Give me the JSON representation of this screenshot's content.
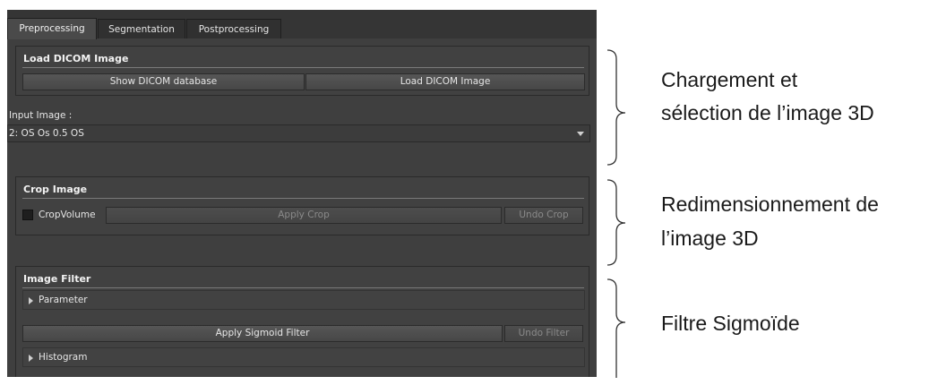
{
  "tabs": [
    {
      "label": "Preprocessing",
      "active": true
    },
    {
      "label": "Segmentation",
      "active": false
    },
    {
      "label": "Postprocessing",
      "active": false
    }
  ],
  "load_dicom": {
    "title": "Load DICOM Image",
    "show_db_button": "Show DICOM database",
    "load_button": "Load DICOM Image",
    "input_label": "Input Image :",
    "input_value": "2: OS Os 0.5   OS"
  },
  "crop": {
    "title": "Crop Image",
    "checkbox_label": "CropVolume",
    "apply_button": "Apply Crop",
    "undo_button": "Undo Crop"
  },
  "filter": {
    "title": "Image Filter",
    "parameter_label": "Parameter",
    "apply_button": "Apply Sigmoid Filter",
    "undo_button": "Undo Filter",
    "histogram_label": "Histogram"
  },
  "annotations": {
    "a1_line1": "Chargement et",
    "a1_line2": "sélection  de l’image 3D",
    "a2_line1": "Redimensionnement de",
    "a2_line2": "l’image 3D",
    "a3_line1": "Filtre Sigmoïde"
  },
  "colors": {
    "panel_bg": "#3f3f3f",
    "text": "#e6e6e6",
    "annotation_text": "#1a1a1a"
  }
}
